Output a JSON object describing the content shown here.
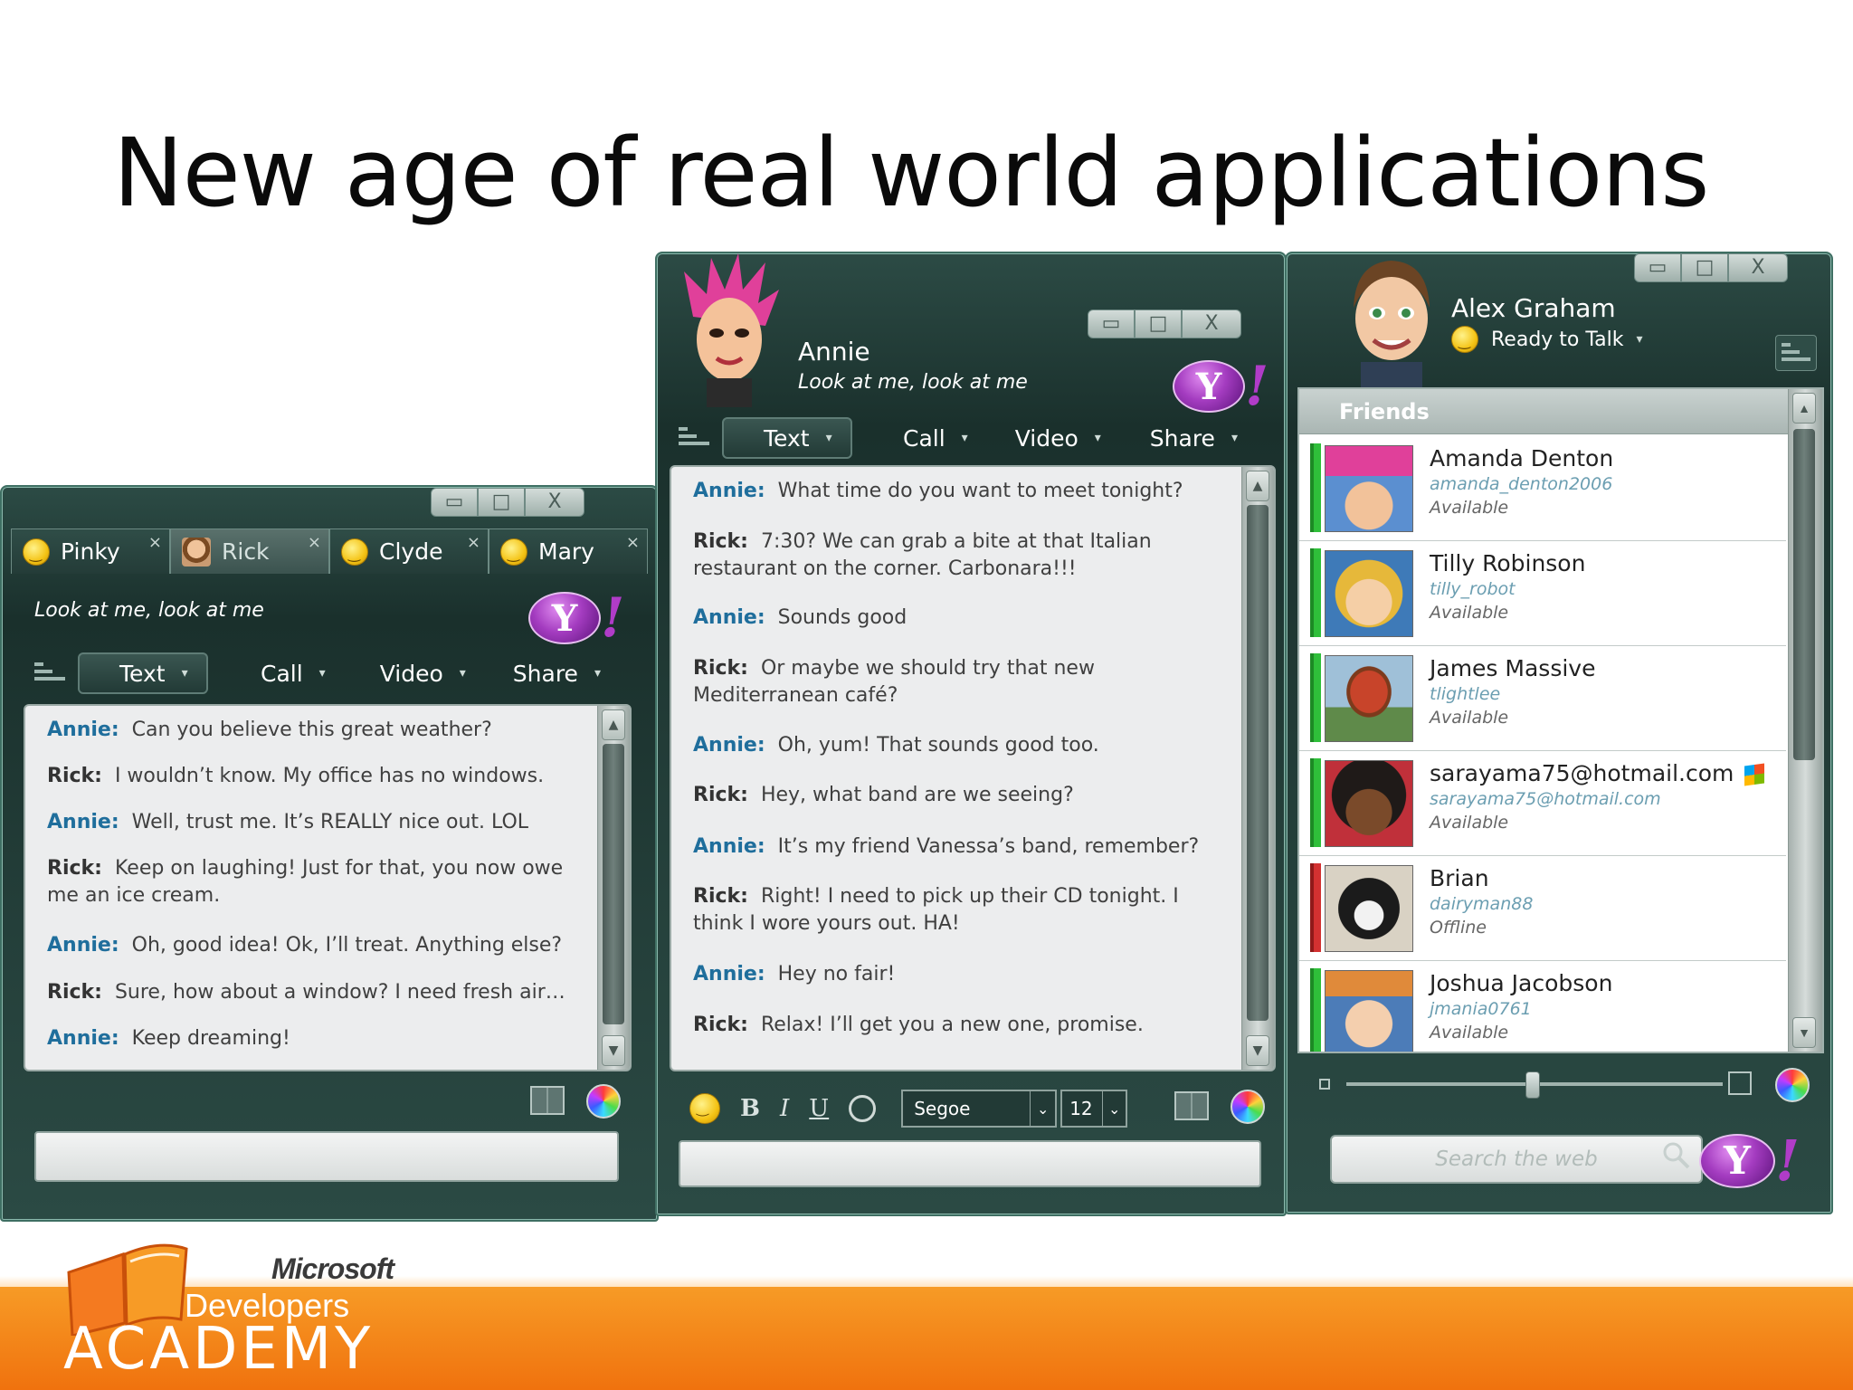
{
  "slide": {
    "title": "New age of real world applications"
  },
  "window_controls": {
    "minimize": "▭",
    "maximize": "□",
    "close": "X"
  },
  "yahoo": {
    "letter": "Y",
    "bang": "!"
  },
  "toolbar": {
    "text": "Text",
    "call": "Call",
    "video": "Video",
    "share": "Share",
    "caret": "▾"
  },
  "left_window": {
    "tabs": [
      {
        "label": "Pinky",
        "close": "×"
      },
      {
        "label": "Rick",
        "close": "×"
      },
      {
        "label": "Clyde",
        "close": "×"
      },
      {
        "label": "Mary",
        "close": "×"
      }
    ],
    "status": "Look at me, look at me",
    "messages": [
      {
        "who": "Annie:",
        "text": "Can you believe this great weather?"
      },
      {
        "who": "Rick:",
        "text": "I wouldn’t know. My office has no windows."
      },
      {
        "who": "Annie:",
        "text": "Well, trust me. It’s REALLY nice out. LOL"
      },
      {
        "who": "Rick:",
        "text": "Keep on laughing! Just for that, you now owe me an ice cream."
      },
      {
        "who": "Annie:",
        "text": "Oh, good idea! Ok, I’ll treat. Anything else?"
      },
      {
        "who": "Rick:",
        "text": "Sure, how about a window? I need fresh air…"
      },
      {
        "who": "Annie:",
        "text": "Keep dreaming!"
      }
    ]
  },
  "middle_window": {
    "name": "Annie",
    "status": "Look at me, look at me",
    "messages": [
      {
        "who": "Annie:",
        "text": "What time do you want to meet tonight?"
      },
      {
        "who": "Rick:",
        "text": "7:30? We can grab a bite at that Italian restaurant on the corner. Carbonara!!!"
      },
      {
        "who": "Annie:",
        "text": "Sounds good"
      },
      {
        "who": "Rick:",
        "text": "Or maybe we should try that new Mediterranean café?"
      },
      {
        "who": "Annie:",
        "text": "Oh, yum! That sounds good too."
      },
      {
        "who": "Rick:",
        "text": "Hey, what band are we seeing?"
      },
      {
        "who": "Annie:",
        "text": "It’s my friend Vanessa’s band, remember?"
      },
      {
        "who": "Rick:",
        "text": "Right! I need to pick up their CD tonight. I think I wore yours out. HA!"
      },
      {
        "who": "Annie:",
        "text": "Hey no fair!"
      },
      {
        "who": "Rick:",
        "text": "Relax! I’ll get you a new one, promise."
      }
    ],
    "format": {
      "bold": "B",
      "italic": "I",
      "underline": "U",
      "font": "Segoe",
      "size": "12"
    }
  },
  "right_window": {
    "user_name": "Alex Graham",
    "user_status": "Ready to Talk",
    "friends_header": "Friends",
    "friends": [
      {
        "name": "Amanda Denton",
        "handle": "amanda_denton2006",
        "status": "Available",
        "online": true
      },
      {
        "name": "Tilly Robinson",
        "handle": "tilly_robot",
        "status": "Available",
        "online": true
      },
      {
        "name": "James Massive",
        "handle": "tlightlee",
        "status": "Available",
        "online": true
      },
      {
        "name": "sarayama75@hotmail.com",
        "handle": "sarayama75@hotmail.com",
        "status": "Available",
        "online": true,
        "msn": true
      },
      {
        "name": "Brian",
        "handle": "dairyman88",
        "status": "Offline",
        "online": false
      },
      {
        "name": "Joshua Jacobson",
        "handle": "jmania0761",
        "status": "Available",
        "online": true
      }
    ],
    "search_placeholder": "Search the web"
  },
  "footer": {
    "microsoft": "Microsoft",
    "developers": "Developers",
    "academy": "ACADEMY"
  },
  "colors": {
    "window_dark": "#1a302c",
    "annie_name": "#1f6e9c",
    "online_green": "#2fbf3a",
    "offline_red": "#d33131",
    "footer_orange": "#f0720e",
    "yahoo_purple": "#a43cc0"
  }
}
